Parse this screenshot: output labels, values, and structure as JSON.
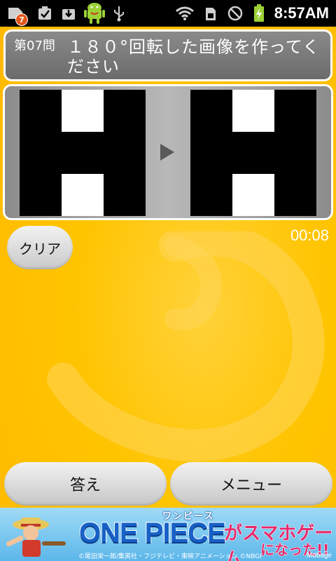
{
  "status_bar": {
    "notification_count": "7",
    "time": "8:57AM",
    "icons": [
      "sim-card-icon",
      "checklist-icon",
      "download-icon",
      "android-icon",
      "usb-icon",
      "wifi-icon",
      "sd-card-icon",
      "no-signal-icon",
      "battery-charging-icon"
    ]
  },
  "question": {
    "number": "第07問",
    "text": "１８０°回転した画像を作ってください"
  },
  "puzzle": {
    "source_pattern": [
      [
        "black",
        "white",
        "black"
      ],
      [
        "black",
        "black",
        "black"
      ],
      [
        "black",
        "white",
        "black"
      ]
    ],
    "answer_pattern": [
      [
        "black",
        "white",
        "black"
      ],
      [
        "black",
        "black",
        "black"
      ],
      [
        "black",
        "white",
        "black"
      ]
    ],
    "arrow_icon": "play-arrow-icon"
  },
  "controls": {
    "clear_label": "クリア",
    "timer": "00:08",
    "answer_label": "答え",
    "menu_label": "メニュー"
  },
  "ad": {
    "subtitle": "ワンピース",
    "logo": "ONE PIECE",
    "tagline_1": "がスマホゲーム",
    "tagline_2": "になった!!",
    "credit": "©尾田栄一郎/集英社・フジテレビ・東映アニメーション ©NBGI",
    "brand": "Mobage"
  },
  "colors": {
    "background": "#ffc400",
    "header_gray": "#7a7a7a",
    "button_light": "#e6e6e6"
  }
}
